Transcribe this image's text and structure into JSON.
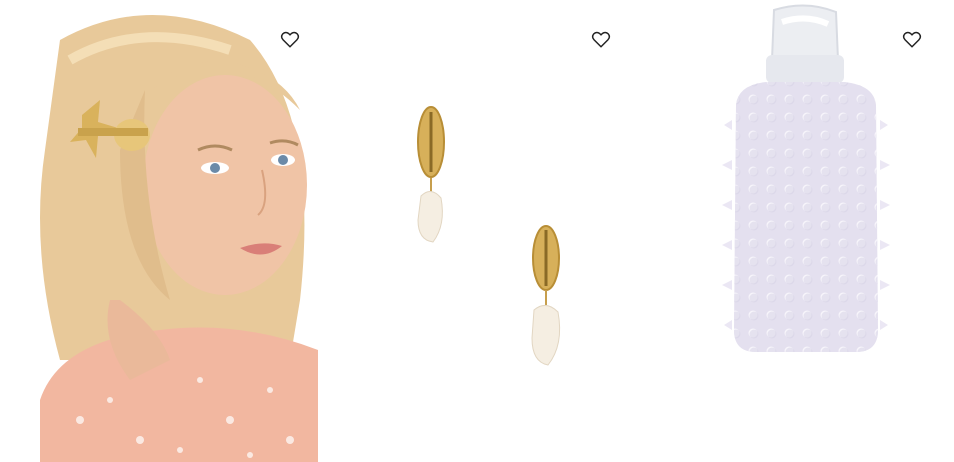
{
  "products": [
    {
      "image": "woman-with-seashell-hair-clip-photo",
      "wishlist_icon": "heart-outline-icon"
    },
    {
      "image": "gold-cowrie-shell-pearl-earrings-photo",
      "wishlist_icon": "heart-outline-icon"
    },
    {
      "image": "lilac-spiked-glass-water-bottle-photo",
      "wishlist_icon": "heart-outline-icon"
    }
  ],
  "colors": {
    "background": "#ffffff",
    "icon": "#222222"
  }
}
